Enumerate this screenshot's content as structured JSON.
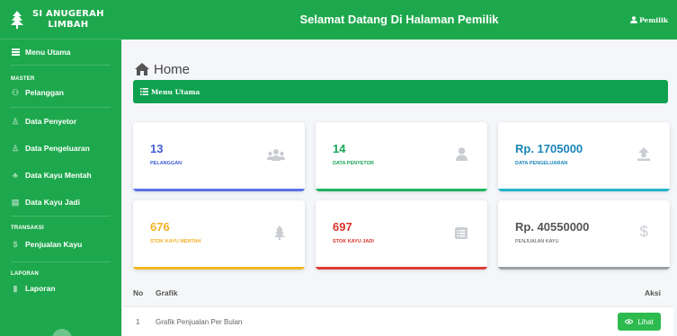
{
  "app": {
    "name_line1": "SI ANUGERAH",
    "name_line2": "LIMBAH"
  },
  "topbar": {
    "title": "Selamat Datang Di Halaman Pemilik",
    "user": "Pemilik"
  },
  "sidebar": {
    "menu_utama": "Menu Utama",
    "heading_master": "MASTER",
    "pelanggan": "Pelanggan",
    "data_penyetor": "Data Penyetor",
    "data_pengeluaran": "Data Pengeluaran",
    "data_kayu_mentah": "Data Kayu Mentah",
    "data_kayu_jadi": "Data Kayu Jadi",
    "heading_transaksi": "TRANSAKSI",
    "penjualan_kayu": "Penjualan Kayu",
    "heading_laporan": "LAPORAN",
    "laporan": "Laporan"
  },
  "main": {
    "page_title": "Home",
    "menu_bar": "Menu Utama",
    "cards": [
      {
        "value": "13",
        "label": "PELANGGAN",
        "color": "#3f5bd6",
        "bar": "#5a72e6",
        "icon": "users-icon"
      },
      {
        "value": "14",
        "label": "DATA PENYETOR",
        "color": "#1aa657",
        "bar": "#1fb45e",
        "icon": "user-icon"
      },
      {
        "value": "Rp. 1705000",
        "label": "DATA PENGELUARAN",
        "color": "#1a86b8",
        "bar": "#22b3c9",
        "icon": "upload-icon"
      },
      {
        "value": "676",
        "label": "STOK KAYU MENTAH",
        "color": "#f2b024",
        "bar": "#f2b824",
        "icon": "tree-icon"
      },
      {
        "value": "697",
        "label": "STOK KAYU JADI",
        "color": "#d9342b",
        "bar": "#dc3b33",
        "icon": "list-icon"
      },
      {
        "value": "Rp. 40550000",
        "label": "PENJUALAN KAYU",
        "color": "#555555",
        "bar": "#9aa0a6",
        "icon": "dollar-icon"
      }
    ],
    "table": {
      "headers": {
        "no": "No",
        "grafik": "Grafik",
        "aksi": "Aksi"
      },
      "rows": [
        {
          "no": "1",
          "grafik": "Grafik Penjualan Per Bulan",
          "action": "Lihat"
        }
      ]
    }
  }
}
